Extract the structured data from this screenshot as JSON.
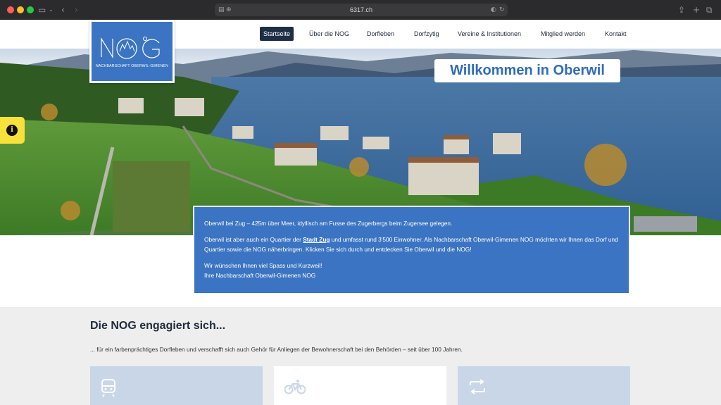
{
  "browser": {
    "url": "6317.ch"
  },
  "logo": {
    "tagline": "NACHBARSCHAFT OBERWIL-GIMENEN"
  },
  "nav": [
    {
      "label": "Startseite",
      "active": true
    },
    {
      "label": "Über die NOG"
    },
    {
      "label": "Dorfleben"
    },
    {
      "label": "Dorfzytig"
    },
    {
      "label": "Vereine & Institutionen"
    },
    {
      "label": "Mitglied werden"
    },
    {
      "label": "Kontakt"
    }
  ],
  "hero": {
    "title": "Willkommen in Oberwil",
    "info_icon": "info-icon"
  },
  "intro": {
    "p1": "Oberwil bei Zug – 425m über Meer, idyllisch am Fusse des Zugerbergs beim Zugersee gelegen.",
    "p2_before": "Oberwil ist aber auch ein Quartier der ",
    "p2_link": "Stadt Zug",
    "p2_after": " und umfasst rund 3'500 Einwohner. Als Nachbarschaft Oberwil-Gimenen NOG möchten wir Ihnen das Dorf und Quartier sowie die NOG näherbringen. Klicken Sie sich durch und entdecken Sie Oberwil und die NOG!",
    "p3_line1": "Wir wünschen Ihnen viel Spass und Kurzweil!",
    "p3_line2": "Ihre Nachbarschaft Oberwil-Gimenen NOG"
  },
  "engaged": {
    "title": "Die NOG engagiert sich...",
    "lead": "... für ein farbenprächtiges Dorfleben und verschafft sich auch Gehör für Anliegen der Bewohnerschaft bei den Behörden – seit über 100 Jahren.",
    "cards": [
      {
        "icon": "train-icon",
        "bg": "#c9d6e8"
      },
      {
        "icon": "bicycle-icon",
        "bg": "#ffffff"
      },
      {
        "icon": "repeat-icon",
        "bg": "#c9d6e8"
      }
    ]
  },
  "colors": {
    "brand_blue": "#3b74c2",
    "nav_active": "#1e2f45",
    "info_yellow": "#f7e13a"
  }
}
